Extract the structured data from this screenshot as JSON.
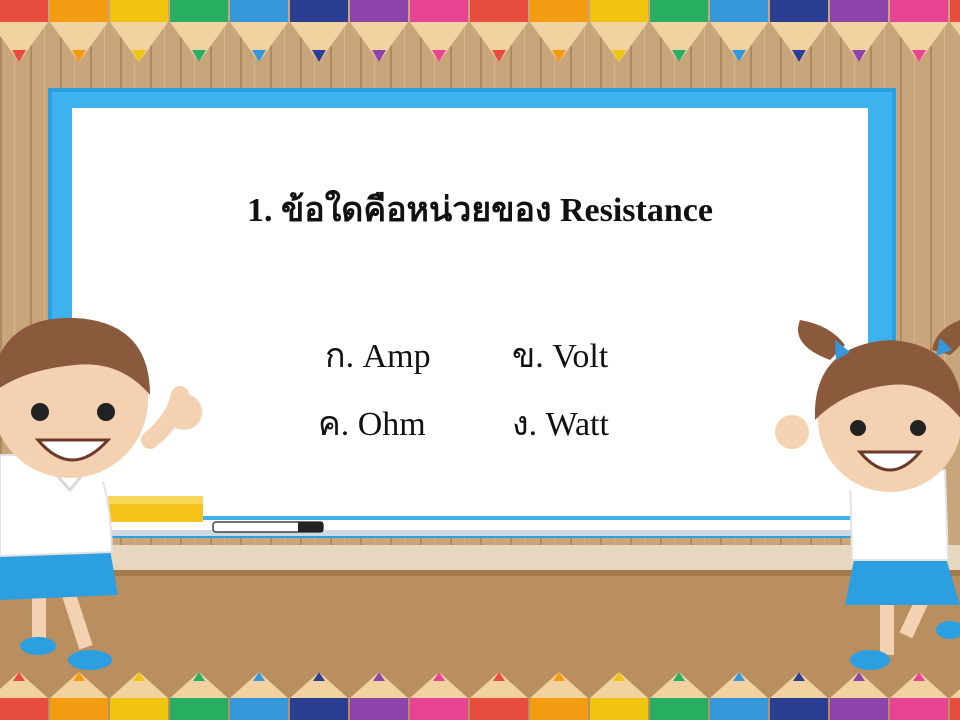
{
  "question": {
    "text": "1. ข้อใดคือหน่วยของ Resistance"
  },
  "options": [
    {
      "text": "ก. Amp"
    },
    {
      "text": "ข. Volt"
    },
    {
      "text": "ค. Ohm"
    },
    {
      "text": "ง. Watt"
    }
  ],
  "colors": {
    "board_frame": "#2b9fe0",
    "board_surface": "#ffffff",
    "wall": "#c9a57b",
    "floor": "#b98f5f",
    "pencil_tips": [
      "#e74c3c",
      "#f39c12",
      "#f1c40f",
      "#27ae60",
      "#3498db",
      "#2c3e91",
      "#8e44ad",
      "#e84393"
    ]
  }
}
